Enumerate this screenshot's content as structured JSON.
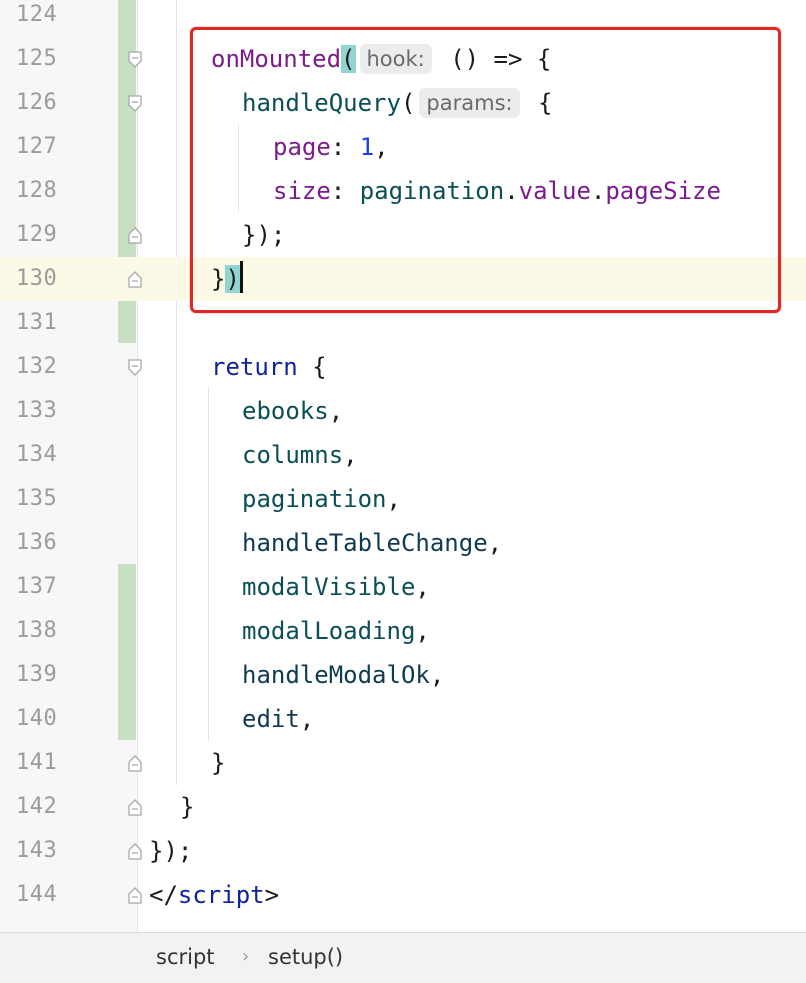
{
  "lines": [
    {
      "num": "124"
    },
    {
      "num": "125"
    },
    {
      "num": "126"
    },
    {
      "num": "127"
    },
    {
      "num": "128"
    },
    {
      "num": "129"
    },
    {
      "num": "130"
    },
    {
      "num": "131"
    },
    {
      "num": "132"
    },
    {
      "num": "133"
    },
    {
      "num": "134"
    },
    {
      "num": "135"
    },
    {
      "num": "136"
    },
    {
      "num": "137"
    },
    {
      "num": "138"
    },
    {
      "num": "139"
    },
    {
      "num": "140"
    },
    {
      "num": "141"
    },
    {
      "num": "142"
    },
    {
      "num": "143"
    },
    {
      "num": "144"
    }
  ],
  "code": {
    "l125_fn": "onMounted",
    "l125_paren": "(",
    "l125_hint": "hook:",
    "l125_rest": " () => {",
    "l126_fn": "handleQuery",
    "l126_paren": "(",
    "l126_hint": "params:",
    "l126_rest": " {",
    "l127_key": "page",
    "l127_colon": ": ",
    "l127_val": "1",
    "l127_end": ",",
    "l128_key": "size",
    "l128_colon": ": ",
    "l128_obj": "pagination",
    "l128_dot1": ".",
    "l128_p1": "value",
    "l128_dot2": ".",
    "l128_p2": "pageSize",
    "l129": "});",
    "l130_brace": "}",
    "l130_paren": ")",
    "l132_kw": "return",
    "l132_rest": " {",
    "l133": "ebooks",
    "l134": "columns",
    "l135": "pagination",
    "l136": "handleTableChange",
    "l137": "modalVisible",
    "l138": "modalLoading",
    "l139": "handleModalOk",
    "l140": "edit",
    "comma": ",",
    "l141": "}",
    "l142": "}",
    "l143": "});",
    "l144_open": "</",
    "l144_tag": "script",
    "l144_close": ">"
  },
  "breadcrumb": {
    "item1": "script",
    "separator": "›",
    "item2": "setup()"
  },
  "colors": {
    "keyword": "#10239e",
    "function": "#0b4f56",
    "property": "#7b1c8c",
    "number": "#1740e6",
    "highlight_box": "#e32626"
  }
}
